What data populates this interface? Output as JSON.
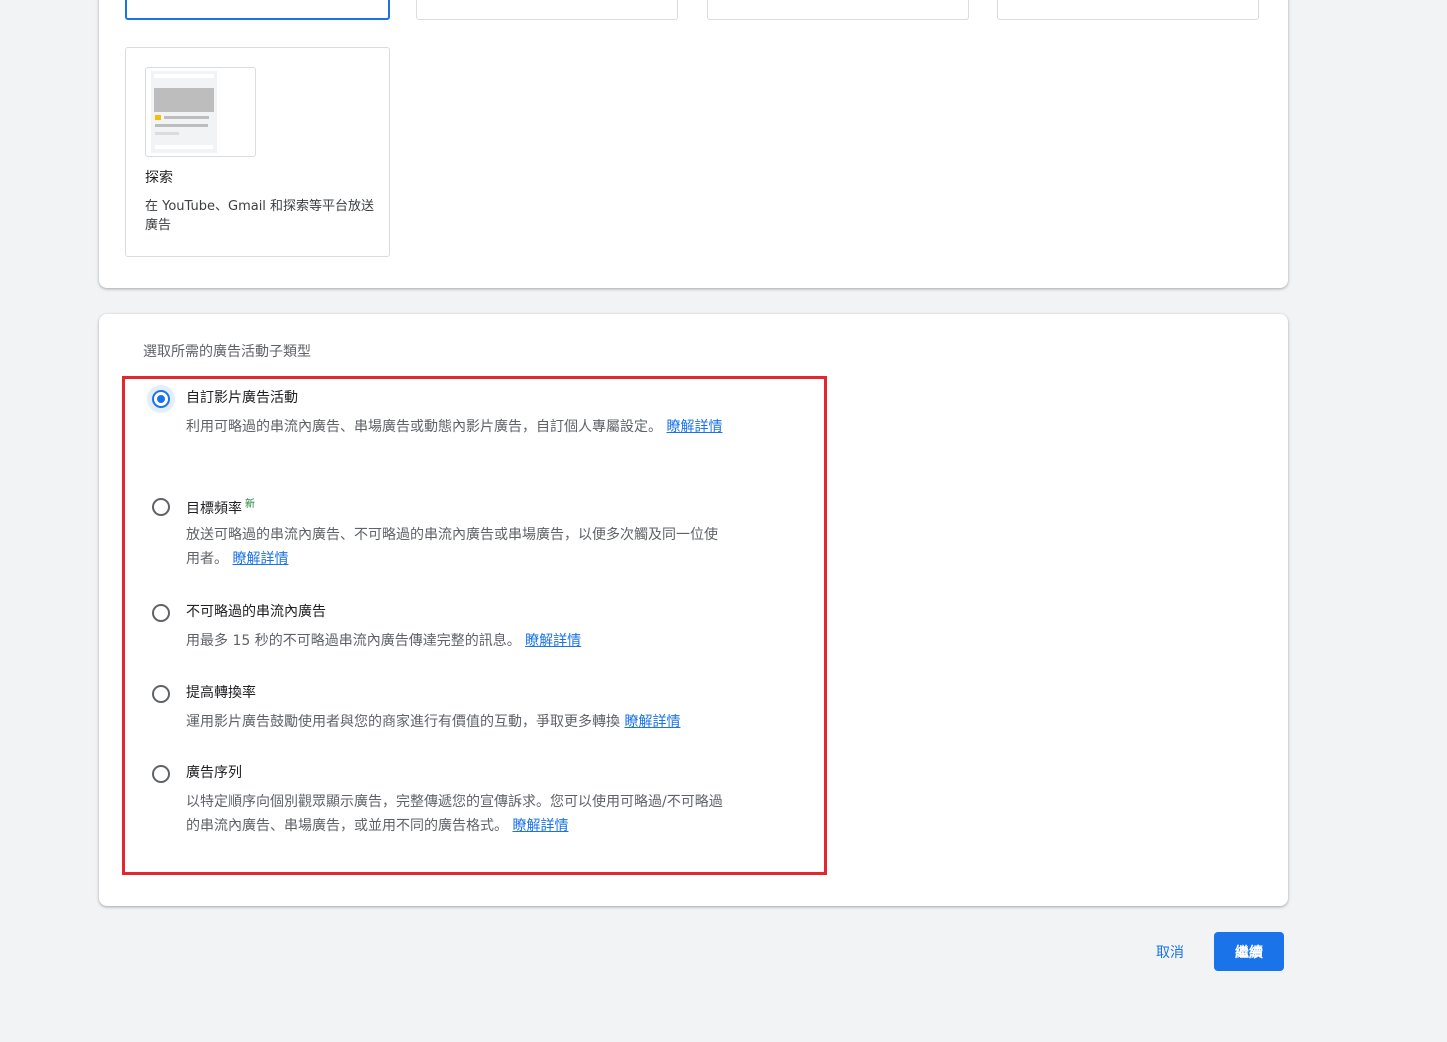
{
  "campaign_types": {
    "selected_index": 0,
    "cards": [
      {
        "title": "探索",
        "description": "在 YouTube、Gmail 和探索等平台放送廣告",
        "icon": "discovery-ad-preview-icon"
      }
    ]
  },
  "subtype_section": {
    "heading": "選取所需的廣告活動子類型",
    "selected_index": 0,
    "options": [
      {
        "title": "自訂影片廣告活動",
        "badge": "",
        "description": "利用可略過的串流內廣告、串場廣告或動態內影片廣告，自訂個人專屬設定。",
        "link": "瞭解詳情"
      },
      {
        "title": "目標頻率",
        "badge": "新",
        "description": "放送可略過的串流內廣告、不可略過的串流內廣告或串場廣告，以便多次觸及同一位使用者。",
        "link": "瞭解詳情"
      },
      {
        "title": "不可略過的串流內廣告",
        "badge": "",
        "description": "用最多 15 秒的不可略過串流內廣告傳達完整的訊息。",
        "link": "瞭解詳情"
      },
      {
        "title": "提高轉換率",
        "badge": "",
        "description": "運用影片廣告鼓勵使用者與您的商家進行有價值的互動，爭取更多轉換",
        "link": "瞭解詳情"
      },
      {
        "title": "廣告序列",
        "badge": "",
        "description": "以特定順序向個別觀眾顯示廣告，完整傳遞您的宣傳訴求。您可以使用可略過/不可略過的串流內廣告、串場廣告，或並用不同的廣告格式。",
        "link": "瞭解詳情"
      }
    ]
  },
  "footer": {
    "cancel_label": "取消",
    "continue_label": "繼續"
  },
  "colors": {
    "accent": "#1a73e8",
    "highlight_border": "#e3262f",
    "new_badge": "#188038"
  }
}
